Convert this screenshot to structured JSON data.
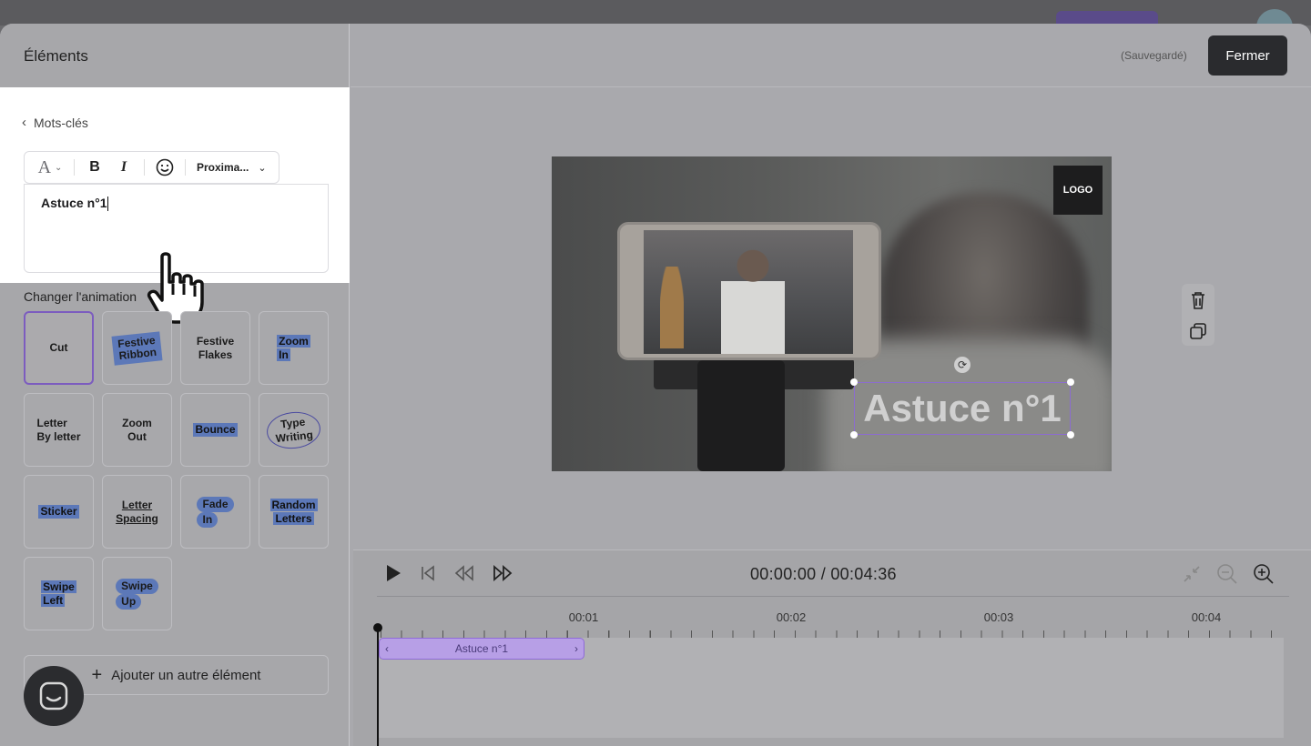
{
  "panel": {
    "title": "Éléments",
    "back_label": "Mots-clés",
    "font_name": "Proxima...",
    "text_value": "Astuce n°1",
    "animation_label": "Changer l'animation",
    "add_label": "Ajouter un autre élément"
  },
  "animations": [
    {
      "line1": "Cut",
      "line2": "",
      "style": "plain",
      "selected": true
    },
    {
      "line1": "Festive",
      "line2": "Ribbon",
      "style": "ribbon",
      "selected": false
    },
    {
      "line1": "Festive",
      "line2": "Flakes",
      "style": "plain",
      "selected": false
    },
    {
      "line1": "Zoom",
      "line2": "In",
      "style": "hl",
      "selected": false
    },
    {
      "line1": "Letter",
      "line2": "By letter",
      "style": "plain",
      "selected": false
    },
    {
      "line1": "Zoom",
      "line2": "Out",
      "style": "plain",
      "selected": false
    },
    {
      "line1": "Bounce",
      "line2": "",
      "style": "hl",
      "selected": false
    },
    {
      "line1": "Type",
      "line2": "Writing",
      "style": "oval",
      "selected": false
    },
    {
      "line1": "Sticker",
      "line2": "",
      "style": "hl",
      "selected": false
    },
    {
      "line1": "Letter",
      "line2": "Spacing",
      "style": "underline",
      "selected": false
    },
    {
      "line1": "Fade",
      "line2": "In",
      "style": "pill",
      "selected": false
    },
    {
      "line1": "Random",
      "line2": "Letters",
      "style": "hl",
      "selected": false
    },
    {
      "line1": "Swipe",
      "line2": "Left",
      "style": "hl",
      "selected": false
    },
    {
      "line1": "Swipe",
      "line2": "Up",
      "style": "pill",
      "selected": false
    }
  ],
  "header": {
    "saved_status": "(Sauvegardé)",
    "close_label": "Fermer"
  },
  "preview": {
    "logo_label": "LOGO",
    "caption_text": "Astuce n°1"
  },
  "timeline": {
    "time_display": "00:00:00 / 00:04:36",
    "tick_labels": [
      "00:01",
      "00:02",
      "00:03",
      "00:04"
    ],
    "clip_label": "Astuce n°1"
  },
  "colors": {
    "accent": "#8f6ad8",
    "highlight": "#5c78b8",
    "close_bg": "#2a2b2e"
  }
}
